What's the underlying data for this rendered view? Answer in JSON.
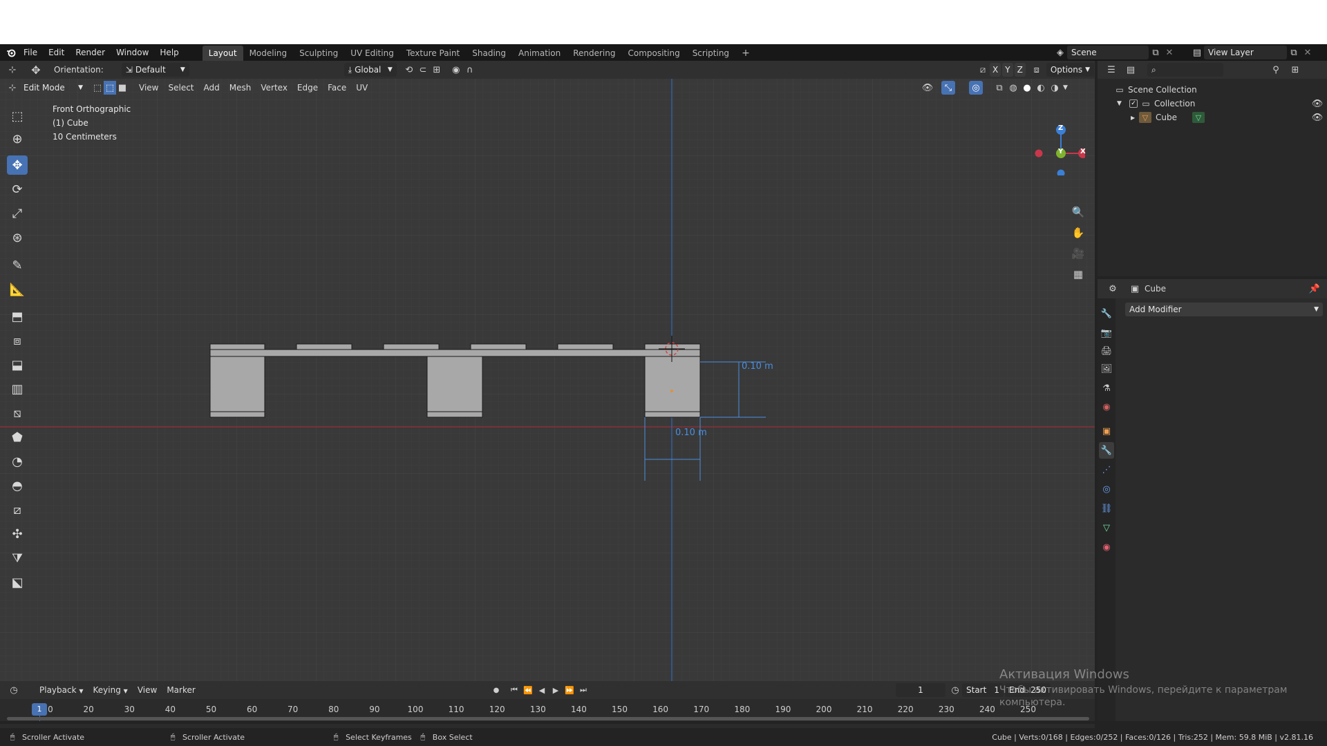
{
  "topmenu": {
    "items": [
      "File",
      "Edit",
      "Render",
      "Window",
      "Help"
    ],
    "workspaces": [
      "Layout",
      "Modeling",
      "Sculpting",
      "UV Editing",
      "Texture Paint",
      "Shading",
      "Animation",
      "Rendering",
      "Compositing",
      "Scripting"
    ],
    "active_workspace": "Layout",
    "scene_label": "Scene",
    "view_layer_label": "View Layer"
  },
  "tool_header": {
    "orientation_label": "Orientation:",
    "orientation_value": "Default",
    "transform_orientation": "Global",
    "axes": [
      "X",
      "Y",
      "Z"
    ],
    "options_label": "Options"
  },
  "viewport_header": {
    "mode": "Edit Mode",
    "menus": [
      "View",
      "Select",
      "Add",
      "Mesh",
      "Vertex",
      "Edge",
      "Face",
      "UV"
    ]
  },
  "viewport": {
    "view_name": "Front Orthographic",
    "object_name": "(1) Cube",
    "grid_scale": "10 Centimeters",
    "dimension_1": "0.10 m",
    "dimension_2": "0.10 m",
    "gizmo_axes": {
      "z": "Z",
      "y": "Y",
      "x": "X"
    }
  },
  "outliner": {
    "scene_collection": "Scene Collection",
    "collection": "Collection",
    "object": "Cube"
  },
  "properties": {
    "object_name": "Cube",
    "add_modifier_label": "Add Modifier"
  },
  "timeline": {
    "menus": [
      "Playback",
      "Keying",
      "View",
      "Marker"
    ],
    "current_frame": "1",
    "start_label": "Start",
    "start_value": "1",
    "end_label": "End",
    "end_value": "250",
    "ticks": [
      "10",
      "20",
      "30",
      "40",
      "50",
      "60",
      "70",
      "80",
      "90",
      "100",
      "110",
      "120",
      "130",
      "140",
      "150",
      "160",
      "170",
      "180",
      "190",
      "200",
      "210",
      "220",
      "230",
      "240",
      "250"
    ],
    "playhead_frame": "1"
  },
  "statusbar": {
    "left_1": "Scroller Activate",
    "left_2": "Scroller Activate",
    "left_3": "Select Keyframes",
    "left_4": "Box Select",
    "stats": "Cube | Verts:0/168 | Edges:0/252 | Faces:0/126 | Tris:252 | Mem: 59.8 MiB | v2.81.16"
  },
  "watermark": {
    "title": "Активация Windows",
    "line1": "Чтобы активировать Windows, перейдите к параметрам",
    "line2": "компьютера."
  },
  "colors": {
    "accent": "#4772b3",
    "x_axis": "#c9374a",
    "y_axis": "#7fb32d",
    "z_axis": "#3b7fd6",
    "dimension": "#4a8fe0"
  }
}
